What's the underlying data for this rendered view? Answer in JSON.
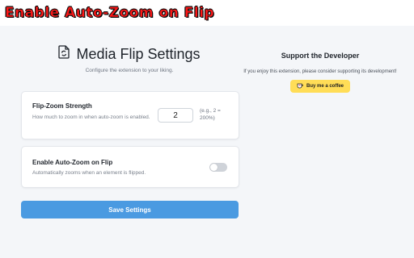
{
  "banner": {
    "text": "Enable Auto-Zoom on Flip"
  },
  "header": {
    "icon": "document-refresh-icon",
    "title": "Media Flip Settings",
    "subtitle": "Configure the extension to your liking."
  },
  "settings": {
    "zoom": {
      "title": "Flip-Zoom Strength",
      "description": "How much to zoom in when auto-zoom is enabled.",
      "value": "2",
      "hint": "(e.g., 2 = 200%)"
    },
    "auto_zoom": {
      "title": "Enable Auto-Zoom on Flip",
      "description": "Automatically zooms when an element is flipped.",
      "enabled": false
    }
  },
  "save_button": {
    "label": "Save Settings"
  },
  "support": {
    "title": "Support the Developer",
    "text": "If you enjoy this extension, please consider supporting its development!",
    "button_label": "Buy me a coffee",
    "button_icon": "coffee-cup-icon"
  },
  "colors": {
    "accent": "#4a9ae1",
    "coffee": "#ffdd57",
    "banner_text": "#ff1616",
    "background": "#f4f6f9"
  }
}
